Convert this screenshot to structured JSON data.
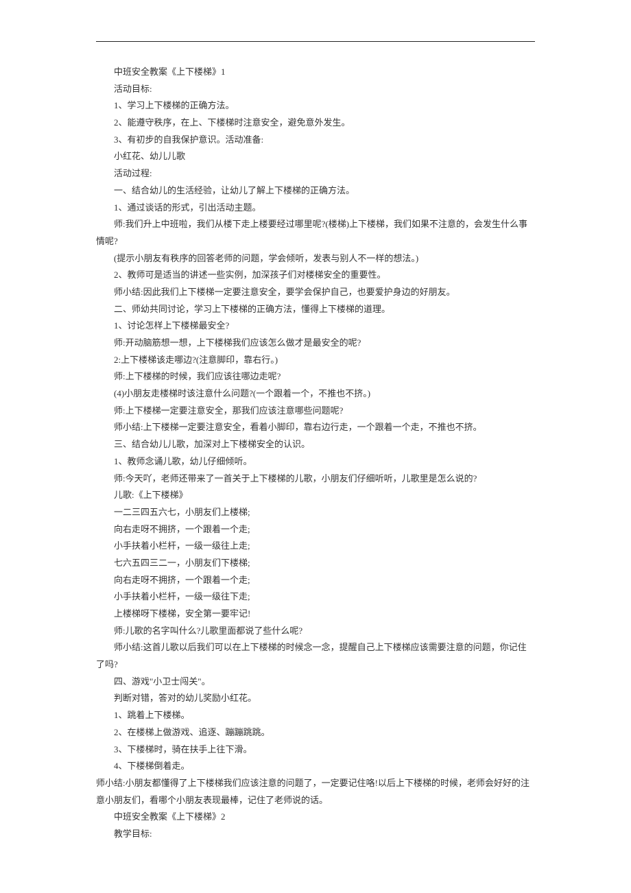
{
  "lines": [
    "中班安全教案《上下楼梯》1",
    "活动目标:",
    "1、学习上下楼梯的正确方法。",
    "2、能遵守秩序，在上、下楼梯时注意安全，避免意外发生。",
    "3、有初步的自我保护意识。活动准备:",
    "小红花、幼儿儿歌",
    "活动过程:",
    "一、结合幼儿的生活经验，让幼儿了解上下楼梯的正确方法。",
    "1、通过谈话的形式，引出活动主题。",
    "师:我们升上中班啦，我们从楼下走上楼要经过哪里呢?(楼梯)上下楼梯，我们如果不注意的，会发生什么事情呢?",
    "(提示小朋友有秩序的回答老师的问题，学会倾听，发表与别人不一样的想法。)",
    "2、教师可是适当的讲述一些实例，加深孩子们对楼梯安全的重要性。",
    "师小结:因此我们上下楼梯一定要注意安全，要学会保护自己，也要爱护身边的好朋友。",
    "二、师幼共同讨论，学习上下楼梯的正确方法，懂得上下楼梯的道理。",
    "1、讨论怎样上下楼梯最安全?",
    "师:开动脑筋想一想，上下楼梯我们应该怎么做才是最安全的呢?",
    "2:上下楼梯该走哪边?(注意脚印，靠右行。)",
    "师:上下楼梯的时候，我们应该往哪边走呢?",
    "(4)小朋友走楼梯时该注意什么问题?(一个跟着一个，不推也不挤。)",
    "师:上下楼梯一定要注意安全，那我们应该注意哪些问题呢?",
    "师小结:上下楼梯一定要注意安全，看着小脚印，靠右边行走，一个跟着一个走，不推也不挤。",
    "三、结合幼儿儿歌，加深对上下楼梯安全的认识。",
    "1、教师念诵儿歌，幼儿仔细倾听。",
    "师:今天吖，老师还带来了一首关于上下楼梯的儿歌，小朋友们仔细听听，儿歌里是怎么说的?",
    "儿歌:《上下楼梯》",
    "一二三四五六七，小朋友们上楼梯;",
    "向右走呀不拥挤，一个跟着一个走;",
    "小手扶着小栏杆，一级一级往上走;",
    "七六五四三二一，小朋友们下楼梯;",
    "向右走呀不拥挤，一个跟着一个走;",
    "小手扶着小栏杆，一级一级往下走;",
    "上楼梯呀下楼梯，安全第一要牢记!",
    "师:儿歌的名字叫什么?儿歌里面都说了些什么呢?",
    "师小结:这首儿歌以后我们可以在上下楼梯的时候念一念，提醒自己上下楼梯应该需要注意的问题，你记住了吗?",
    "四、游戏\"小卫士闯关\"。",
    "判断对错，答对的幼儿奖励小红花。",
    "1、跳着上下楼梯。",
    "2、在楼梯上做游戏、追逐、蹦蹦跳跳。",
    "3、下楼梯时，骑在扶手上往下滑。",
    "4、下楼梯倒着走。",
    "师小结:小朋友都懂得了上下楼梯我们应该注意的问题了，一定要记住咯!以后上下楼梯的时候，老师会好好的注意小朋友们，看哪个小朋友表现最棒，记住了老师说的话。",
    "中班安全教案《上下楼梯》2",
    "教学目标:"
  ],
  "noIndentIndexes": [
    40
  ]
}
